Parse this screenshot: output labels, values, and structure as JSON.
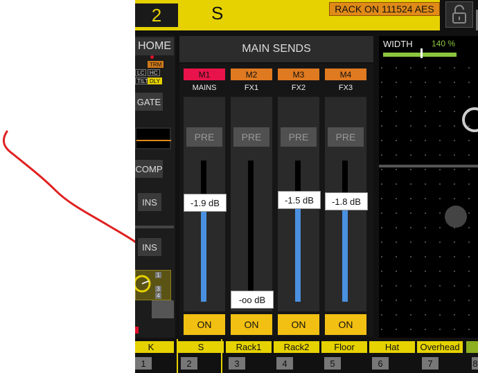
{
  "colors": {
    "accent_yellow": "#e6d200",
    "orange": "#e08a18",
    "mains_red": "#e8134a",
    "fader_blue": "#4a90e0",
    "on_yellow": "#f2c012",
    "width_green": "#8cc63f",
    "annotation_red": "#e02020"
  },
  "header": {
    "channel_number": "2",
    "channel_name": "S",
    "rack_badge": "RACK ON 111524 AES",
    "lock_icon": "unlock-icon"
  },
  "sidebar": {
    "home": "HOME",
    "tags": {
      "trm": "TRM",
      "lc": "LC",
      "hc": "HC",
      "tilt": "TILT",
      "dly": "DLY"
    },
    "gate": "GATE",
    "comp": "COMP",
    "ins1": "INS",
    "ins2": "INS",
    "fx_numbers": [
      "1",
      "3",
      "4"
    ]
  },
  "main_sends": {
    "title": "MAIN SENDS",
    "strips": [
      {
        "label": "M1",
        "sub": "MAINS",
        "pre": "PRE",
        "value": "-1.9 dB",
        "level": 0.64,
        "on": "ON",
        "color": "#e8134a"
      },
      {
        "label": "M2",
        "sub": "FX1",
        "pre": "PRE",
        "value": "-oo dB",
        "level": 0,
        "on": "ON",
        "color": "#e07a20"
      },
      {
        "label": "M3",
        "sub": "FX2",
        "pre": "PRE",
        "value": "-1.5 dB",
        "level": 0.66,
        "on": "ON",
        "color": "#e07a20"
      },
      {
        "label": "M4",
        "sub": "FX3",
        "pre": "PRE",
        "value": "-1.8 dB",
        "level": 0.65,
        "on": "ON",
        "color": "#e07a20"
      }
    ]
  },
  "width": {
    "label": "WIDTH",
    "value": "140 %"
  },
  "channel_bar": [
    {
      "name": "K",
      "num": "1"
    },
    {
      "name": "S",
      "num": "2"
    },
    {
      "name": "Rack1",
      "num": "3"
    },
    {
      "name": "Rack2",
      "num": "4"
    },
    {
      "name": "Floor",
      "num": "5"
    },
    {
      "name": "Hat",
      "num": "6"
    },
    {
      "name": "Overhead",
      "num": "7"
    },
    {
      "name": "",
      "num": "8"
    }
  ]
}
